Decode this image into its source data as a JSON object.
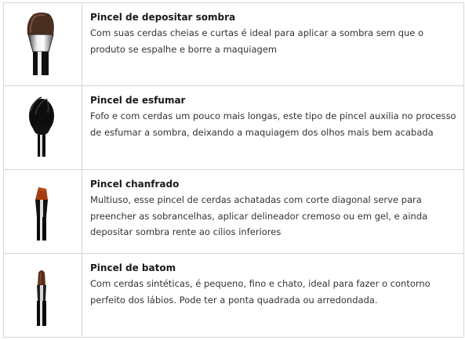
{
  "brushes": [
    {
      "name": "Pincel de depositar sombra",
      "description": "Com suas cerdas cheias e curtas é ideal para aplicar a sombra sem que o produto se espalhe e borre a maquiagem",
      "icon": "flat-shader-brush-icon"
    },
    {
      "name": "Pincel de esfumar",
      "description": "Fofo e com cerdas um pouco mais longas, este tipo de pincel auxilia no processo de esfumar a sombra, deixando a maquiagem dos olhos mais bem acabada",
      "icon": "blending-brush-icon"
    },
    {
      "name": "Pincel chanfrado",
      "description": "Multiuso, esse pincel de cerdas achatadas com corte diagonal serve para preencher as sobrancelhas, aplicar delineador cremoso ou em gel, e ainda depositar sombra rente ao cílios inferiores",
      "icon": "angled-brush-icon"
    },
    {
      "name": "Pincel de batom",
      "description": "Com cerdas sintéticas, é pequeno, fino e chato, ideal para fazer o contorno perfeito dos lábios. Pode ter a ponta quadrada ou arredondada.",
      "icon": "lip-brush-icon"
    }
  ]
}
